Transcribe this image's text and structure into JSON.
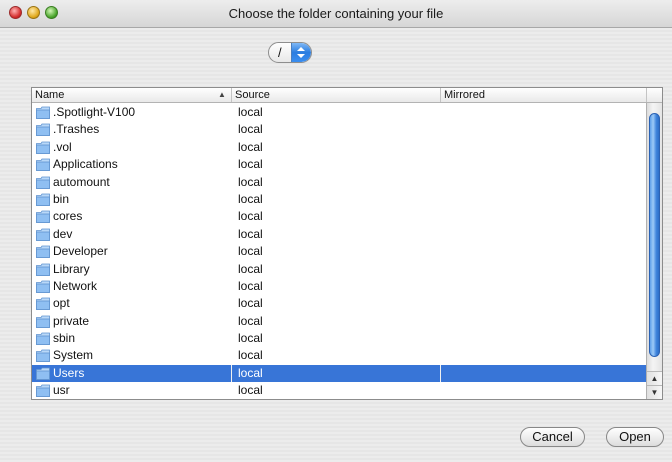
{
  "window": {
    "title": "Choose the folder containing your file"
  },
  "path_popup": {
    "value": "/"
  },
  "table": {
    "columns": [
      "Name",
      "Source",
      "Mirrored"
    ],
    "sort_column": "Name",
    "sort_direction": "ascending",
    "rows": [
      {
        "name": ".Spotlight-V100",
        "source": "local",
        "mirrored": ""
      },
      {
        "name": ".Trashes",
        "source": "local",
        "mirrored": ""
      },
      {
        "name": ".vol",
        "source": "local",
        "mirrored": ""
      },
      {
        "name": "Applications",
        "source": "local",
        "mirrored": ""
      },
      {
        "name": "automount",
        "source": "local",
        "mirrored": ""
      },
      {
        "name": "bin",
        "source": "local",
        "mirrored": ""
      },
      {
        "name": "cores",
        "source": "local",
        "mirrored": ""
      },
      {
        "name": "dev",
        "source": "local",
        "mirrored": ""
      },
      {
        "name": "Developer",
        "source": "local",
        "mirrored": ""
      },
      {
        "name": "Library",
        "source": "local",
        "mirrored": ""
      },
      {
        "name": "Network",
        "source": "local",
        "mirrored": ""
      },
      {
        "name": "opt",
        "source": "local",
        "mirrored": ""
      },
      {
        "name": "private",
        "source": "local",
        "mirrored": ""
      },
      {
        "name": "sbin",
        "source": "local",
        "mirrored": ""
      },
      {
        "name": "System",
        "source": "local",
        "mirrored": ""
      },
      {
        "name": "Users",
        "source": "local",
        "mirrored": "",
        "selected": true
      },
      {
        "name": "usr",
        "source": "local",
        "mirrored": ""
      }
    ],
    "selected_row": "Users"
  },
  "buttons": {
    "cancel_label": "Cancel",
    "open_label": "Open"
  },
  "colors": {
    "selection": "#3875d7",
    "scroll_thumb": "#3f84dc",
    "folder_icon": "#8fbff2"
  },
  "icons": {
    "row_icon": "folder-icon",
    "popup_stepper": "up-down-arrows-icon",
    "sort_indicator": "sort-ascending-icon"
  }
}
